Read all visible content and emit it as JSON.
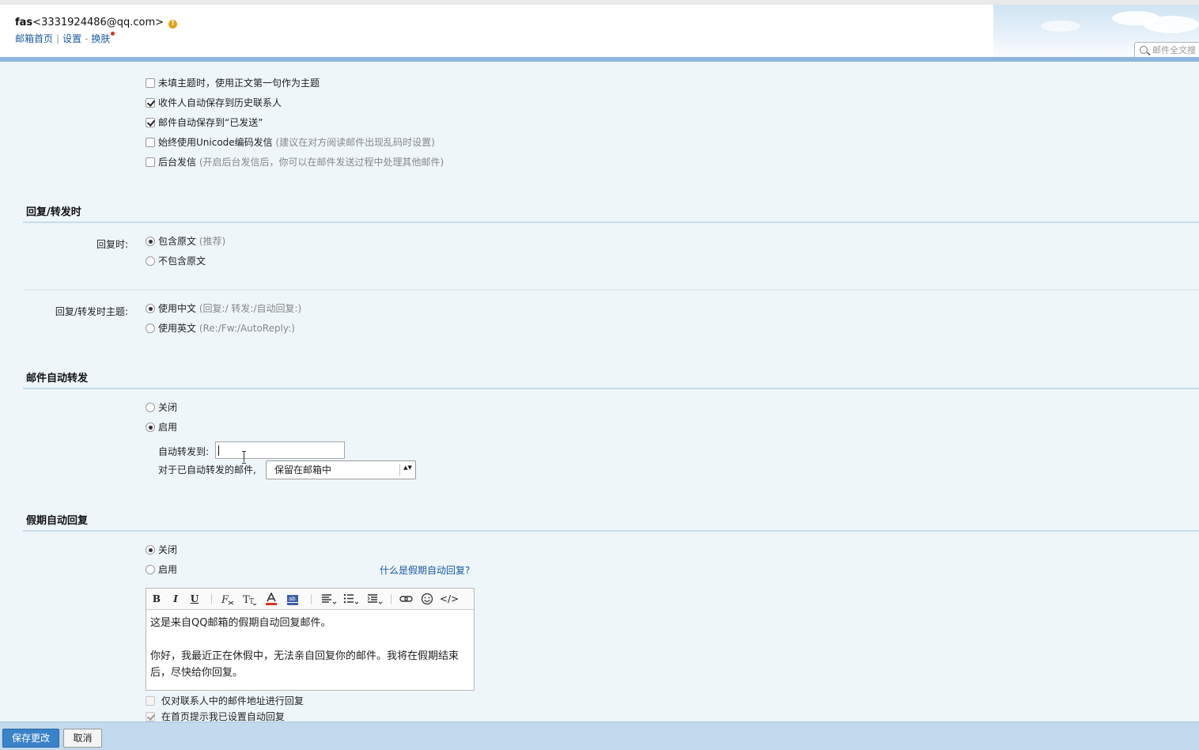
{
  "header": {
    "account_name": "fas",
    "account_email": "<3331924486@qq.com>",
    "warning_glyph": "!",
    "links": [
      "邮箱首页",
      "设置",
      "换肤"
    ],
    "link_sep1": "|",
    "link_sep2": "-",
    "search_placeholder": "邮件全文搜"
  },
  "send_options": [
    {
      "label": "未填主题时，使用正文第一句作为主题",
      "hint": "",
      "checked": false
    },
    {
      "label": "收件人自动保存到历史联系人",
      "hint": "",
      "checked": true
    },
    {
      "label": "邮件自动保存到“已发送”",
      "hint": "",
      "checked": true
    },
    {
      "label": "始终使用Unicode编码发信",
      "hint": "(建议在对方阅读邮件出现乱码时设置)",
      "checked": false
    },
    {
      "label": "后台发信",
      "hint": "(开启后台发信后，你可以在邮件发送过程中处理其他邮件)",
      "checked": false
    }
  ],
  "reply_section": {
    "title": "回复/转发时",
    "reply_label": "回复时:",
    "reply_opt1": "包含原文",
    "reply_opt1_hint": "(推荐)",
    "reply_opt2": "不包含原文",
    "subject_label": "回复/转发时主题:",
    "subject_opt1": "使用中文",
    "subject_opt1_hint": "(回复:/ 转发:/自动回复:)",
    "subject_opt2": "使用英文",
    "subject_opt2_hint": "(Re:/Fw:/AutoReply:)"
  },
  "forward_section": {
    "title": "邮件自动转发",
    "off_label": "关闭",
    "on_label": "启用",
    "selected": "启用",
    "forward_to_label": "自动转发到:",
    "forward_to_value": "",
    "after_forward_label": "对于已自动转发的邮件,",
    "after_forward_value": "保留在邮箱中",
    "select_arrow": "▲▼"
  },
  "vacation_section": {
    "title": "假期自动回复",
    "off_label": "关闭",
    "on_label": "启用",
    "selected": "关闭",
    "help_link": "什么是假期自动回复?",
    "toolbar": {
      "bold": "B",
      "italic": "I",
      "underline": "U",
      "code": "</>"
    },
    "message_line1": "这是来自QQ邮箱的假期自动回复邮件。",
    "message_line2": "你好，我最近正在休假中，无法亲自回复你的邮件。我将在假期结束后，尽快给你回复。",
    "opt_contacts_only": "仅对联系人中的邮件地址进行回复",
    "opt_contacts_only_checked": false,
    "opt_homepage_notice": "在首页提示我已设置自动回复",
    "opt_homepage_notice_checked": true
  },
  "footer": {
    "save_label": "保存更改",
    "cancel_label": "取消"
  },
  "colors": {
    "brand_bar": "#8fb6dc",
    "link": "#1b5aa6",
    "primary_button": "#3b83c8",
    "warning": "#e3a214",
    "content_bg": "#eef6fa"
  }
}
